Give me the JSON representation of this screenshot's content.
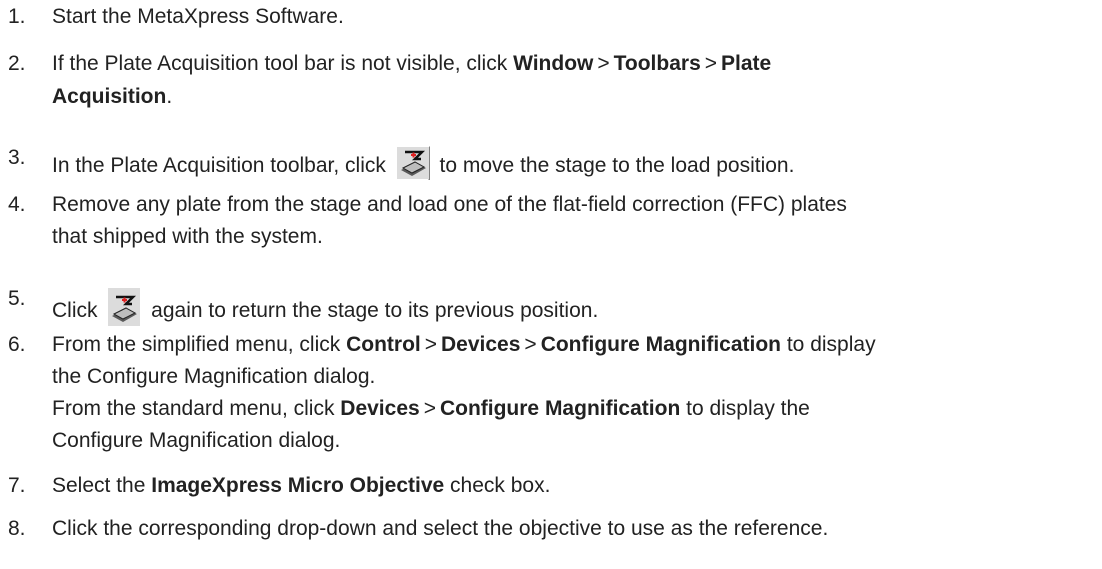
{
  "steps": [
    {
      "num": "1.",
      "text": "Start the MetaXpress Software."
    },
    {
      "num": "2.",
      "pre": "If the Plate Acquisition tool bar is not visible, click ",
      "menu1": "Window",
      "menu2": "Toolbars",
      "menu3_a": "Plate",
      "menu3_b": "Acquisition",
      "post": "."
    },
    {
      "num": "3.",
      "pre": "In the Plate Acquisition toolbar, click ",
      "icon": "load-position-icon",
      "post": " to move the stage to the load position."
    },
    {
      "num": "4.",
      "line1": "Remove any plate from the stage and load one of the flat-field correction (FFC) plates",
      "line2": "that shipped with the system."
    },
    {
      "num": "5.",
      "pre": "Click ",
      "icon": "load-position-icon",
      "post": " again to return the stage to its previous position."
    },
    {
      "num": "6.",
      "pre": "From the simplified menu, click ",
      "menu1": "Control",
      "menu2": "Devices",
      "menu3": "Configure Magnification",
      "post": " to display",
      "line2": "the Configure Magnification dialog.",
      "alt_pre": "From the standard menu, click ",
      "alt_menu1": "Devices",
      "alt_menu2": "Configure Magnification",
      "alt_post": " to display the",
      "alt_line2": "Configure Magnification dialog."
    },
    {
      "num": "7.",
      "pre": "Select the ",
      "bold": "ImageXpress Micro Objective",
      "post": " check box."
    },
    {
      "num": "8.",
      "text": "Click the corresponding drop-down and select the objective to use as the reference."
    }
  ],
  "menu_separator": ">"
}
